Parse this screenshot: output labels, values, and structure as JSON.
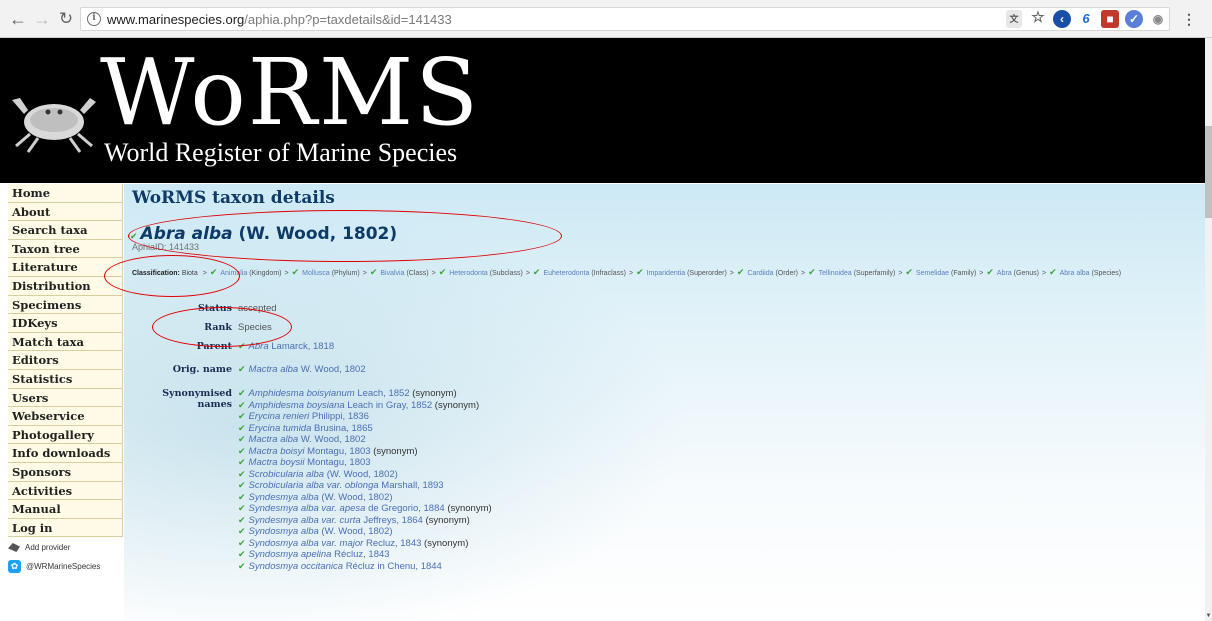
{
  "browser": {
    "url_host": "www.marinespecies.org",
    "url_path": "/aphia.php?p=taxdetails&id=141433",
    "back_icon": "arrow-left",
    "forward_icon": "arrow-right",
    "reload_icon": "reload",
    "info_icon": "info-circle",
    "star_icon": "star",
    "menu_icon": "vertical-ellipsis"
  },
  "banner": {
    "title": "WoRMS",
    "subtitle": "World Register of Marine Species",
    "background": "#000000"
  },
  "sidebar": {
    "items": [
      {
        "label": "Home"
      },
      {
        "label": "About"
      },
      {
        "label": "Search taxa"
      },
      {
        "label": "Taxon tree"
      },
      {
        "label": "Literature"
      },
      {
        "label": "Distribution"
      },
      {
        "label": "Specimens"
      },
      {
        "label": "IDKeys"
      },
      {
        "label": "Match taxa"
      },
      {
        "label": "Editors"
      },
      {
        "label": "Statistics"
      },
      {
        "label": "Users"
      },
      {
        "label": "Webservice"
      },
      {
        "label": "Photogallery"
      },
      {
        "label": "Info downloads"
      },
      {
        "label": "Sponsors"
      },
      {
        "label": "Activities"
      },
      {
        "label": "Manual"
      },
      {
        "label": "Log in"
      }
    ],
    "add_provider": "Add provider",
    "twitter": "@WRMarineSpecies"
  },
  "main": {
    "page_title": "WoRMS taxon details",
    "taxon_name": "Abra alba",
    "taxon_author": "(W. Wood, 1802)",
    "aphia_id": "AphiaID: 141433",
    "classification_label": "Classification:",
    "classification_root": "Biota",
    "classification": [
      {
        "name": "Animalia",
        "rank": "(Kingdom)"
      },
      {
        "name": "Mollusca",
        "rank": "(Phylum)"
      },
      {
        "name": "Bivalvia",
        "rank": "(Class)"
      },
      {
        "name": "Heterodonta",
        "rank": "(Subclass)"
      },
      {
        "name": "Euheterodonta",
        "rank": "(Infraclass)"
      },
      {
        "name": "Imparidentia",
        "rank": "(Superorder)"
      },
      {
        "name": "Cardiida",
        "rank": "(Order)"
      },
      {
        "name": "Tellinoidea",
        "rank": "(Superfamily)"
      },
      {
        "name": "Semelidae",
        "rank": "(Family)"
      },
      {
        "name": "Abra",
        "rank": "(Genus)"
      },
      {
        "name": "Abra alba",
        "rank": "(Species)"
      }
    ],
    "status_label": "Status",
    "status_value": "accepted",
    "rank_label": "Rank",
    "rank_value": "Species",
    "parent_label": "Parent",
    "parent_name": "Abra",
    "parent_author": "Lamarck, 1818",
    "orig_label": "Orig. name",
    "orig_name": "Mactra alba",
    "orig_author": "W. Wood, 1802",
    "syn_label_1": "Synonymised",
    "syn_label_2": "names",
    "synonyms": [
      {
        "name": "Amphidesma boisyianum",
        "author": "Leach, 1852",
        "note": "(synonym)"
      },
      {
        "name": "Amphidesma boysiana",
        "author": "Leach in Gray, 1852",
        "note": "(synonym)"
      },
      {
        "name": "Erycina renieri",
        "author": "Philippi, 1836",
        "note": ""
      },
      {
        "name": "Erycina tumida",
        "author": "Brusina, 1865",
        "note": ""
      },
      {
        "name": "Mactra alba",
        "author": "W. Wood, 1802",
        "note": ""
      },
      {
        "name": "Mactra boisyi",
        "author": "Montagu, 1803",
        "note": "(synonym)"
      },
      {
        "name": "Mactra boysii",
        "author": "Montagu, 1803",
        "note": ""
      },
      {
        "name": "Scrobicularia alba",
        "author": "(W. Wood, 1802)",
        "note": ""
      },
      {
        "name": "Scrobicularia alba var. oblonga",
        "author": "Marshall, 1893",
        "note": ""
      },
      {
        "name": "Syndesmya alba",
        "author": "(W. Wood, 1802)",
        "note": ""
      },
      {
        "name": "Syndesmya alba var. apesa",
        "author": "de Gregorio, 1884",
        "note": "(synonym)"
      },
      {
        "name": "Syndesmya alba var. curta",
        "author": "Jeffreys, 1864",
        "note": "(synonym)"
      },
      {
        "name": "Syndosmya alba",
        "author": "(W. Wood, 1802)",
        "note": ""
      },
      {
        "name": "Syndosmya alba var. major",
        "author": "Recluz, 1843",
        "note": "(synonym)"
      },
      {
        "name": "Syndosmya apelina",
        "author": "Récluz, 1843",
        "note": ""
      },
      {
        "name": "Syndosmya occitanica",
        "author": "Récluz in Chenu, 1844",
        "note": ""
      }
    ]
  },
  "colors": {
    "accent": "#0d3b66",
    "link": "#4a6fb5",
    "check": "#3aa43a",
    "annotation": "#e00000",
    "sidebar_bg": "#fffbe6"
  }
}
